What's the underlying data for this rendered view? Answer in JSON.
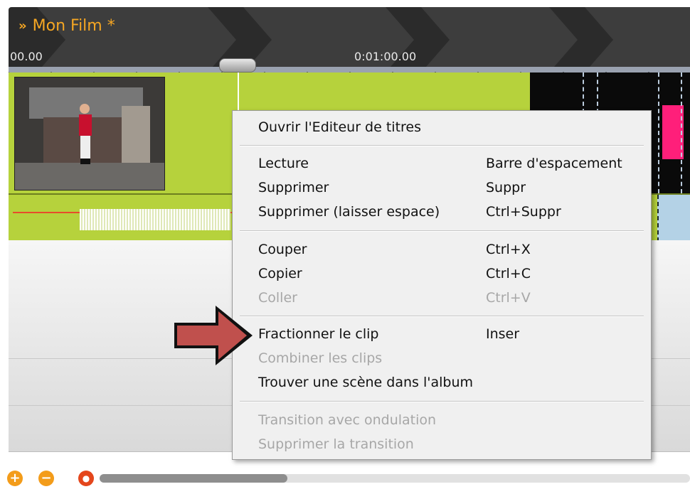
{
  "header": {
    "title": "Mon Film *",
    "title_marker": "»",
    "time_start": "00.00",
    "time_mid": "0:01:00.00"
  },
  "context_menu": {
    "items": [
      {
        "label": "Ouvrir l'Editeur de titres",
        "shortcut": "",
        "enabled": true
      },
      {
        "label": "Lecture",
        "shortcut": "Barre d'espacement",
        "enabled": true
      },
      {
        "label": "Supprimer",
        "shortcut": "Suppr",
        "enabled": true
      },
      {
        "label": "Supprimer (laisser espace)",
        "shortcut": "Ctrl+Suppr",
        "enabled": true
      },
      {
        "label": "Couper",
        "shortcut": "Ctrl+X",
        "enabled": true
      },
      {
        "label": "Copier",
        "shortcut": "Ctrl+C",
        "enabled": true
      },
      {
        "label": "Coller",
        "shortcut": "Ctrl+V",
        "enabled": false
      },
      {
        "label": "Fractionner le clip",
        "shortcut": "Inser",
        "enabled": true
      },
      {
        "label": "Combiner les clips",
        "shortcut": "",
        "enabled": false
      },
      {
        "label": "Trouver une scène dans l'album",
        "shortcut": "",
        "enabled": true
      },
      {
        "label": "Transition avec ondulation",
        "shortcut": "",
        "enabled": false
      },
      {
        "label": "Supprimer la transition",
        "shortcut": "",
        "enabled": false
      }
    ]
  },
  "bottom_bar": {
    "zoom_in_icon": "plus-circle-icon",
    "zoom_out_icon": "minus-circle-icon",
    "record_icon": "record-icon",
    "scroll_position": 0.0
  },
  "colors": {
    "track_green": "#b6d23c",
    "title_orange": "#f5a623",
    "highlight_arrow": "#c0504d",
    "pink_clip": "#ff1f7a"
  }
}
